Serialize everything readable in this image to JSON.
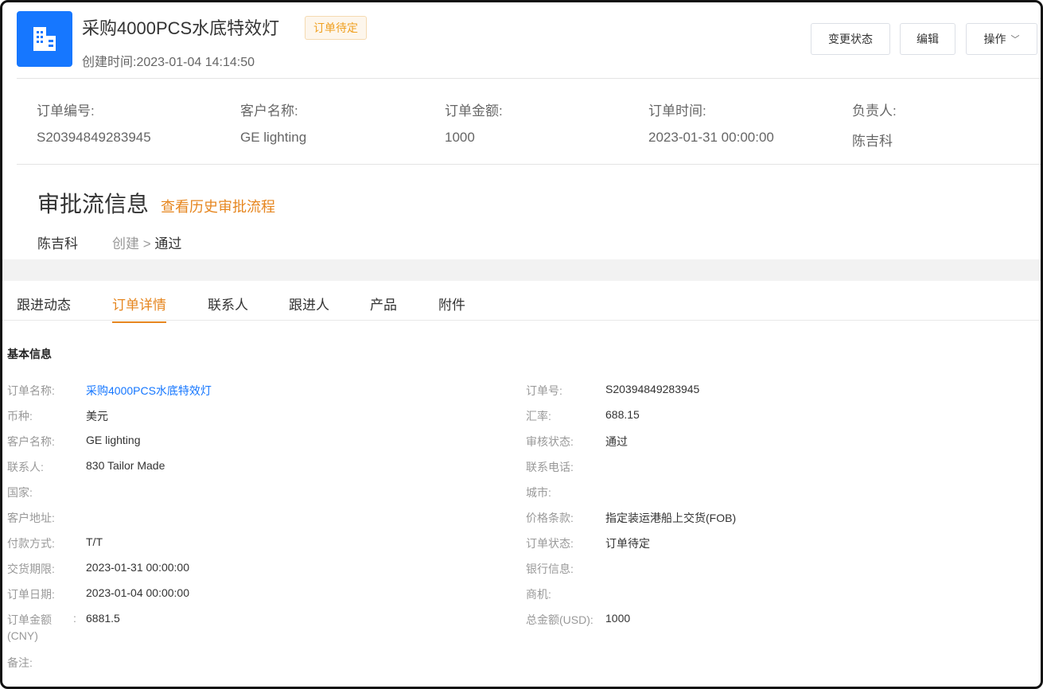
{
  "header": {
    "title": "采购4000PCS水底特效灯",
    "status_badge": "订单待定",
    "created": "创建时间:2023-01-04 14:14:50",
    "logo_icon": "building-icon",
    "buttons": {
      "change_status": "变更状态",
      "edit": "编辑",
      "operations": "操作"
    }
  },
  "summary": [
    {
      "label": "订单编号:",
      "value": "S20394849283945"
    },
    {
      "label": "客户名称:",
      "value": "GE lighting"
    },
    {
      "label": "订单金额:",
      "value": "1000"
    },
    {
      "label": "订单时间:",
      "value": "2023-01-31 00:00:00"
    },
    {
      "label": "负责人:",
      "value": "陈吉科"
    }
  ],
  "approval": {
    "title": "审批流信息",
    "history_link": "查看历史审批流程",
    "person": "陈吉科",
    "step_created": "创建",
    "separator": ">",
    "step_result": "通过"
  },
  "tabs": [
    "跟进动态",
    "订单详情",
    "联系人",
    "跟进人",
    "产品",
    "附件"
  ],
  "active_tab": "订单详情",
  "details": {
    "section_title": "基本信息",
    "left": [
      {
        "label": "订单名称:",
        "value": "采购4000PCS水底特效灯"
      },
      {
        "label": "币种:",
        "value": "美元"
      },
      {
        "label": "客户名称:",
        "value": "GE lighting"
      },
      {
        "label": "联系人:",
        "value": "830 Tailor Made"
      },
      {
        "label": "国家:",
        "value": ""
      },
      {
        "label": "客户地址:",
        "value": ""
      },
      {
        "label": "付款方式:",
        "value": "T/T"
      },
      {
        "label": "交货期限:",
        "value": "2023-01-31 00:00:00"
      },
      {
        "label": "订单日期:",
        "value": "2023-01-04 00:00:00"
      },
      {
        "label": "订单金额",
        "label_line2": "(CNY)",
        "colon": ":",
        "value": "6881.5"
      },
      {
        "label": "备注:",
        "value": ""
      }
    ],
    "right": [
      {
        "label": "订单号:",
        "value": "S20394849283945"
      },
      {
        "label": "汇率:",
        "value": "688.15"
      },
      {
        "label": "审核状态:",
        "value": "通过"
      },
      {
        "label": "联系电话:",
        "value": ""
      },
      {
        "label": "城市:",
        "value": ""
      },
      {
        "label": "价格条款:",
        "value": "指定装运港船上交货(FOB)"
      },
      {
        "label": "订单状态:",
        "value": "订单待定"
      },
      {
        "label": "银行信息:",
        "value": ""
      },
      {
        "label": "商机:",
        "value": ""
      },
      {
        "label": "总金额(USD):",
        "value": "1000"
      }
    ]
  },
  "colors": {
    "primary": "#1677ff",
    "accent": "#e6861f",
    "badge_bg": "#fdf6ec"
  }
}
